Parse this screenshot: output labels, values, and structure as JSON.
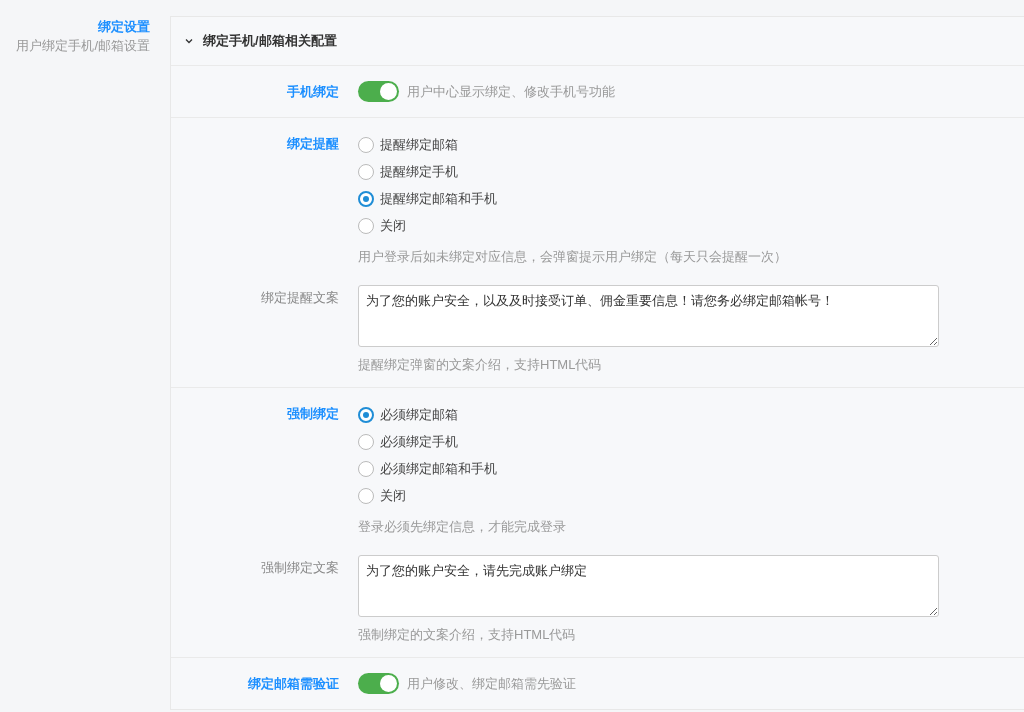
{
  "sidebar": {
    "title": "绑定设置",
    "subtitle": "用户绑定手机/邮箱设置"
  },
  "panel": {
    "title": "绑定手机/邮箱相关配置",
    "expanded": true,
    "groups": [
      {
        "fields": [
          {
            "kind": "switch",
            "label": "手机绑定",
            "on": true,
            "help": "用户中心显示绑定、修改手机号功能"
          }
        ]
      },
      {
        "fields": [
          {
            "kind": "radio",
            "label": "绑定提醒",
            "options": [
              {
                "label": "提醒绑定邮箱",
                "selected": false
              },
              {
                "label": "提醒绑定手机",
                "selected": false
              },
              {
                "label": "提醒绑定邮箱和手机",
                "selected": true
              },
              {
                "label": "关闭",
                "selected": false
              }
            ],
            "help": "用户登录后如未绑定对应信息，会弹窗提示用户绑定（每天只会提醒一次）"
          },
          {
            "kind": "textarea",
            "label": "绑定提醒文案",
            "value": "为了您的账户安全，以及及时接受订单、佣金重要信息！请您务必绑定邮箱帐号！",
            "help": "提醒绑定弹窗的文案介绍，支持HTML代码"
          }
        ]
      },
      {
        "fields": [
          {
            "kind": "radio",
            "label": "强制绑定",
            "options": [
              {
                "label": "必须绑定邮箱",
                "selected": true
              },
              {
                "label": "必须绑定手机",
                "selected": false
              },
              {
                "label": "必须绑定邮箱和手机",
                "selected": false
              },
              {
                "label": "关闭",
                "selected": false
              }
            ],
            "help": "登录必须先绑定信息，才能完成登录"
          },
          {
            "kind": "textarea",
            "label": "强制绑定文案",
            "value": "为了您的账户安全，请先完成账户绑定",
            "help": "强制绑定的文案介绍，支持HTML代码"
          }
        ]
      },
      {
        "fields": [
          {
            "kind": "switch",
            "label": "绑定邮箱需验证",
            "on": true,
            "help": "用户修改、绑定邮箱需先验证"
          }
        ]
      }
    ]
  }
}
